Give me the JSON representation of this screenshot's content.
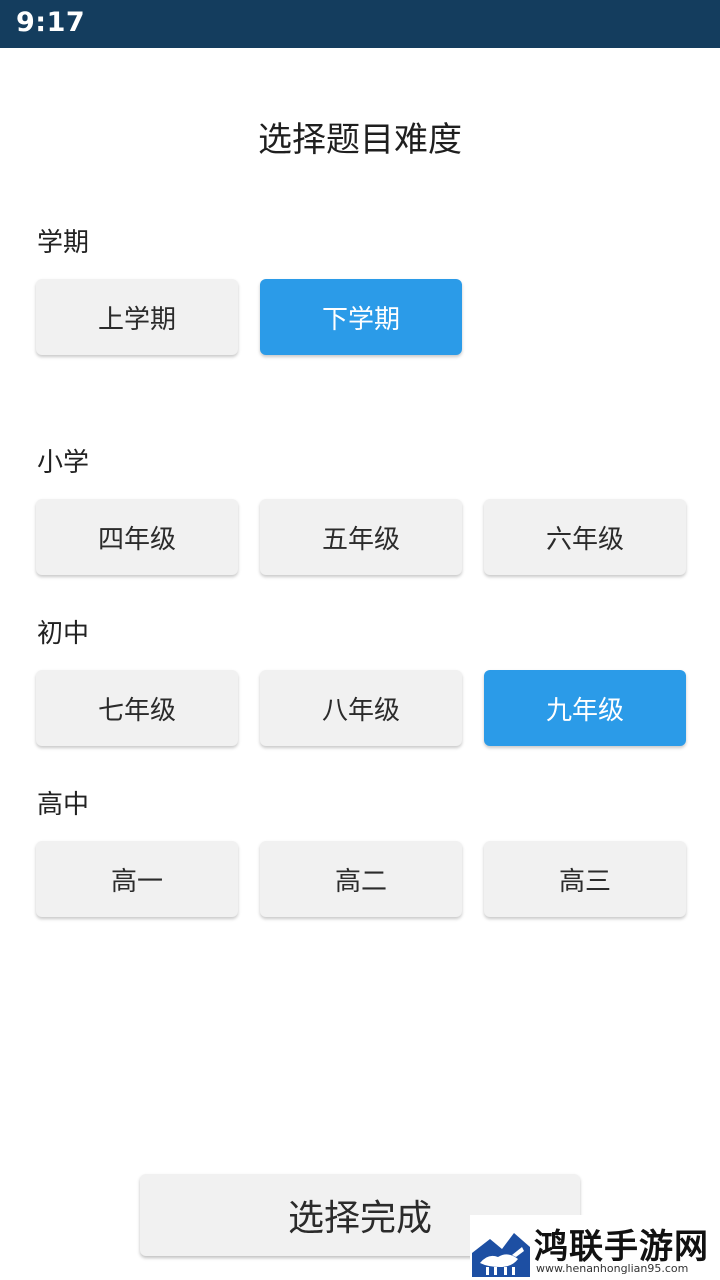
{
  "status_bar": {
    "time": "9:17"
  },
  "title": "选择题目难度",
  "sections": {
    "semester": {
      "label": "学期",
      "options": [
        {
          "label": "上学期",
          "selected": false
        },
        {
          "label": "下学期",
          "selected": true
        }
      ]
    },
    "primary": {
      "label": "小学",
      "options": [
        {
          "label": "四年级",
          "selected": false
        },
        {
          "label": "五年级",
          "selected": false
        },
        {
          "label": "六年级",
          "selected": false
        }
      ]
    },
    "junior": {
      "label": "初中",
      "options": [
        {
          "label": "七年级",
          "selected": false
        },
        {
          "label": "八年级",
          "selected": false
        },
        {
          "label": "九年级",
          "selected": true
        }
      ]
    },
    "senior": {
      "label": "高中",
      "options": [
        {
          "label": "高一",
          "selected": false
        },
        {
          "label": "高二",
          "selected": false
        },
        {
          "label": "高三",
          "selected": false
        }
      ]
    }
  },
  "done_button": "选择完成",
  "watermark": {
    "text": "鸿联手游网",
    "url": "www.henanhonglian95.com"
  },
  "colors": {
    "status_bar": "#143d5e",
    "selected": "#2b9be8",
    "button": "#f1f1f1"
  },
  "icons": {
    "watermark_logo": "bull-logo-icon"
  }
}
